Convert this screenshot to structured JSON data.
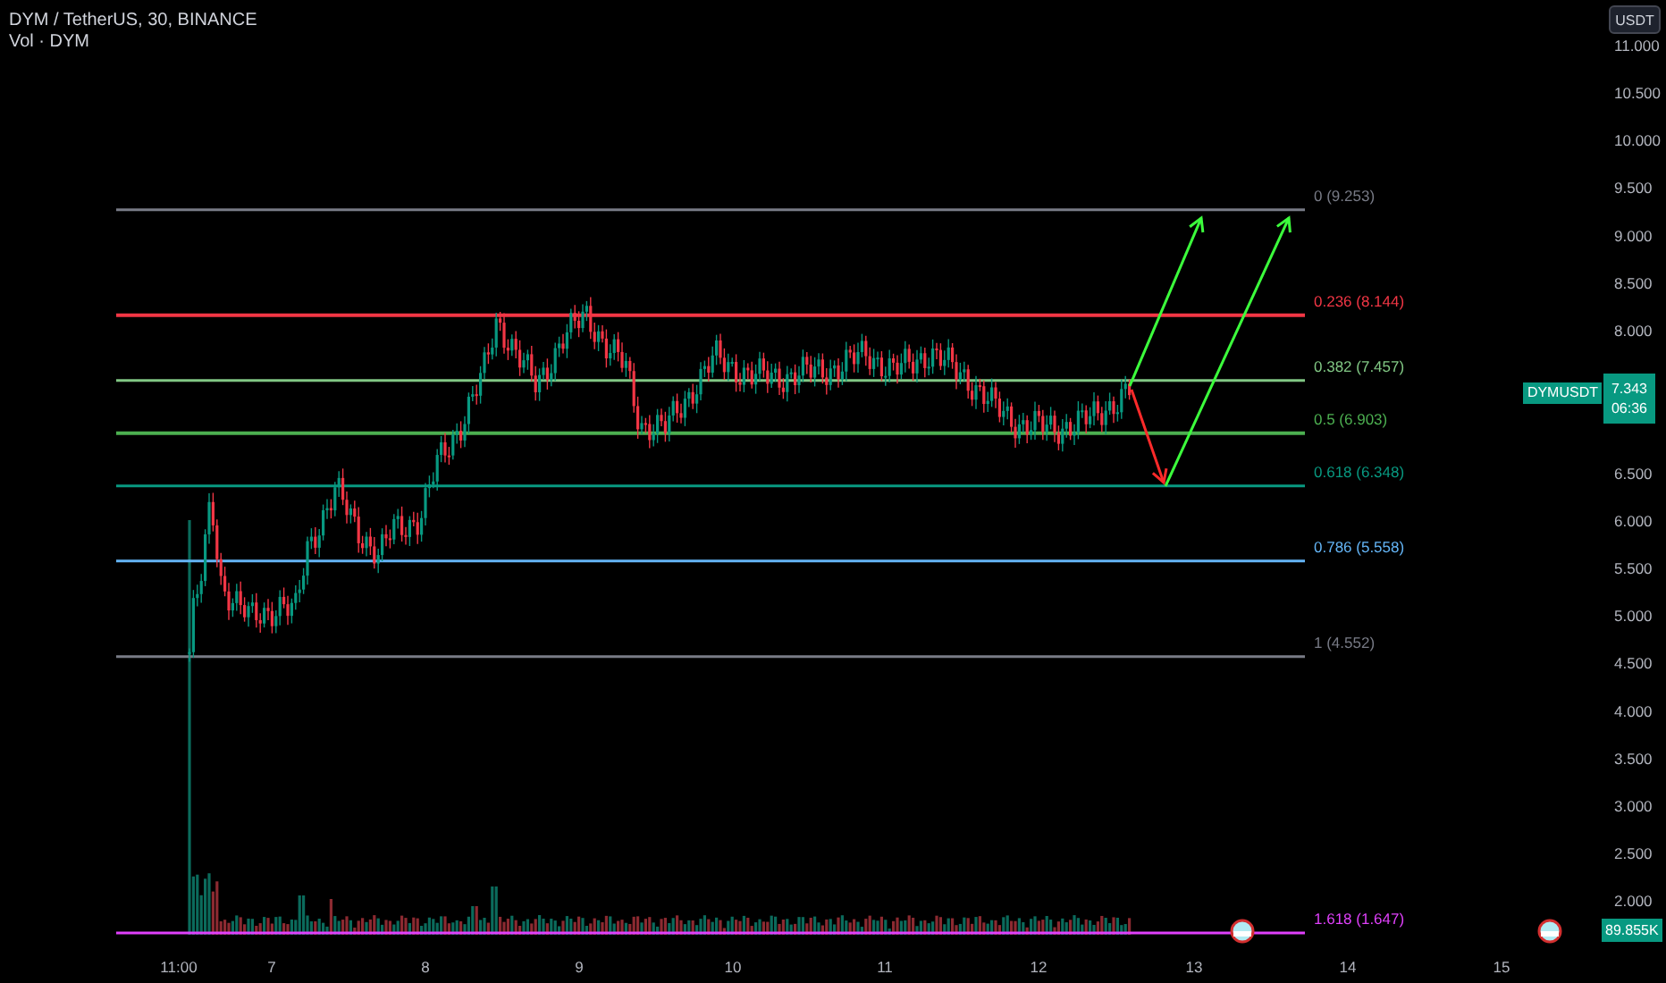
{
  "header": {
    "symbol": "DYM / TetherUS, 30, BINANCE",
    "volume_label": "Vol · DYM"
  },
  "currency_button": "USDT",
  "price_axis": [
    "11.000",
    "10.500",
    "10.000",
    "9.500",
    "9.000",
    "8.500",
    "8.000",
    "6.500",
    "6.000",
    "5.500",
    "5.000",
    "4.500",
    "4.000",
    "3.500",
    "3.000",
    "2.500",
    "2.000"
  ],
  "time_axis": [
    "11:00",
    "7",
    "8",
    "9",
    "10",
    "11",
    "12",
    "13",
    "14",
    "15"
  ],
  "fib_levels": [
    {
      "label": "0 (9.253)",
      "color": "#787b86"
    },
    {
      "label": "0.236 (8.144)",
      "color": "#f23645"
    },
    {
      "label": "0.382 (7.457)",
      "color": "#81c784"
    },
    {
      "label": "0.5 (6.903)",
      "color": "#4caf50"
    },
    {
      "label": "0.618 (6.348)",
      "color": "#089981"
    },
    {
      "label": "0.786 (5.558)",
      "color": "#64b5f6"
    },
    {
      "label": "1 (4.552)",
      "color": "#787b86"
    },
    {
      "label": "1.618 (1.647)",
      "color": "#e040fb"
    }
  ],
  "price_tag": {
    "symbol": "DYMUSDT",
    "price": "7.343",
    "countdown": "06:36"
  },
  "volume_tag": "89.855K"
}
